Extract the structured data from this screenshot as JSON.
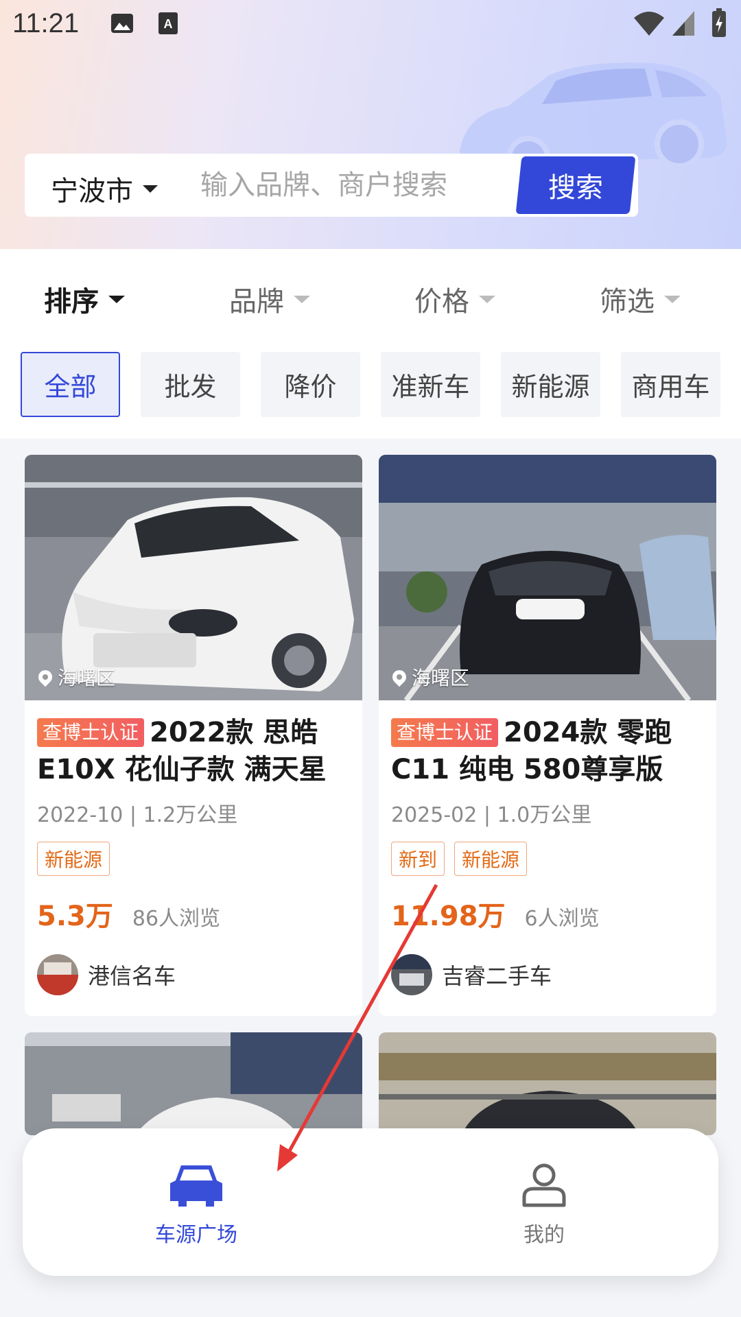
{
  "status_bar": {
    "time": "11:21",
    "left_icons": [
      "image-icon",
      "font-download-icon"
    ],
    "right_icons": [
      "wifi-icon",
      "signal-icon",
      "battery-charging-icon"
    ]
  },
  "search": {
    "city": "宁波市",
    "placeholder": "输入品牌、商户搜索",
    "value": "",
    "button_label": "搜索"
  },
  "sort_bar": {
    "items": [
      {
        "label": "排序",
        "active": true
      },
      {
        "label": "品牌",
        "active": false
      },
      {
        "label": "价格",
        "active": false
      },
      {
        "label": "筛选",
        "active": false
      }
    ]
  },
  "categories": [
    {
      "label": "全部",
      "active": true
    },
    {
      "label": "批发",
      "active": false
    },
    {
      "label": "降价",
      "active": false
    },
    {
      "label": "准新车",
      "active": false
    },
    {
      "label": "新能源",
      "active": false
    },
    {
      "label": "商用车",
      "active": false
    }
  ],
  "listings": [
    {
      "location": "海曙区",
      "cert_badge": "查博士认证",
      "title": "2022款 思皓E10X 花仙子款 满天星",
      "meta": "2022-10 | 1.2万公里",
      "tags": [
        "新能源"
      ],
      "price": "5.3万",
      "views": "86人浏览",
      "dealer": "港信名车"
    },
    {
      "location": "海曙区",
      "cert_badge": "查博士认证",
      "title": "2024款 零跑C11 纯电 580尊享版",
      "meta": "2025-02 | 1.0万公里",
      "tags": [
        "新到",
        "新能源"
      ],
      "price": "11.98万",
      "views": "6人浏览",
      "dealer": "吉睿二手车"
    }
  ],
  "bottom_nav": {
    "items": [
      {
        "label": "车源广场",
        "icon": "car-icon",
        "active": true
      },
      {
        "label": "我的",
        "icon": "person-icon",
        "active": false
      }
    ]
  },
  "colors": {
    "accent": "#3348d8",
    "price": "#e3641a",
    "annotation_arrow": "#e53935"
  }
}
